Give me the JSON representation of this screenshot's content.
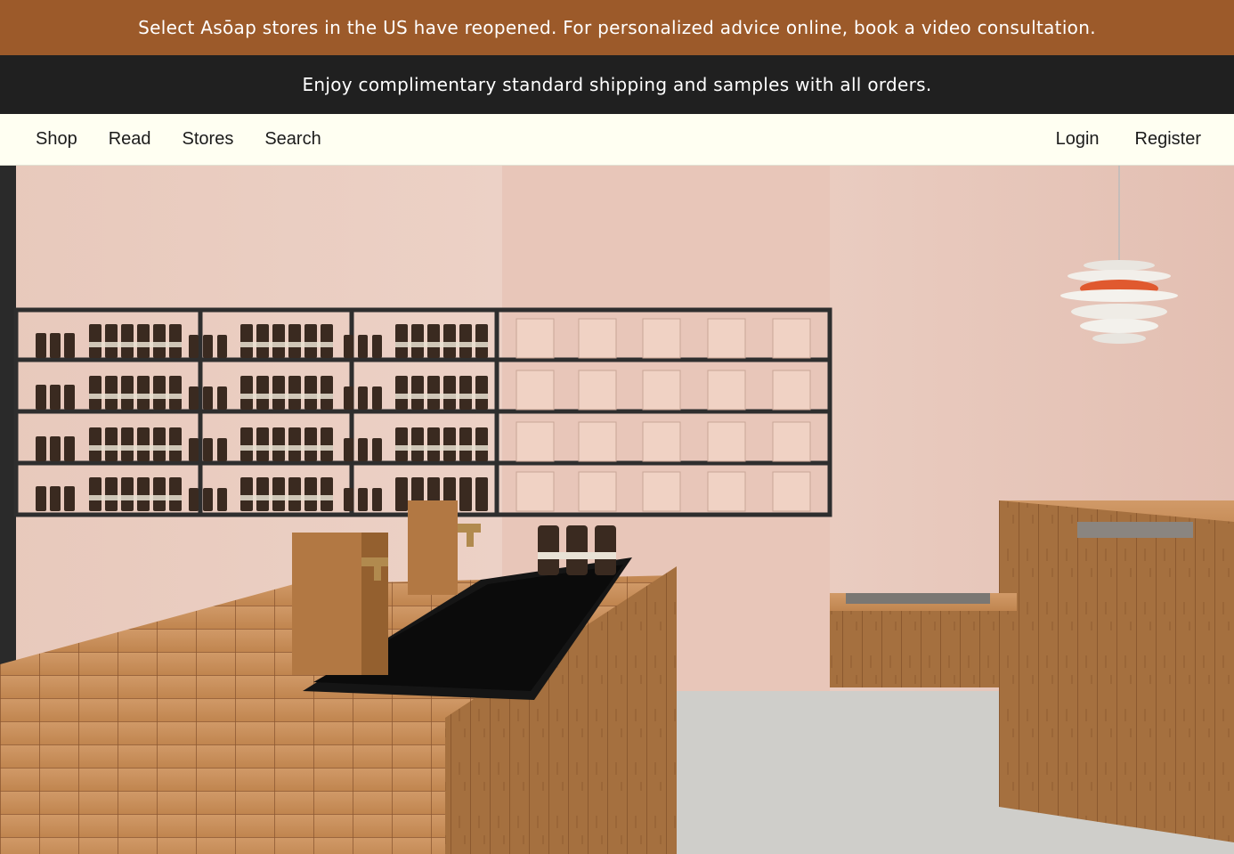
{
  "announcements": {
    "primary": "Select Asōap stores in the US have reopened. For personalized advice online, book a video consultation.",
    "secondary": "Enjoy complimentary standard shipping and samples with all orders."
  },
  "nav": {
    "left": [
      "Shop",
      "Read",
      "Stores",
      "Search"
    ],
    "right": [
      "Login",
      "Register"
    ]
  },
  "hero": {
    "alt": "Store interior with wooden sink counters and product shelves"
  },
  "colors": {
    "announcement_bg": "#9c5a2a",
    "shipping_bar_bg": "#202020",
    "nav_bg": "#fffff2",
    "wall": "#e6c5b8",
    "wood": "#b47a48",
    "floor": "#c9c8c4"
  }
}
